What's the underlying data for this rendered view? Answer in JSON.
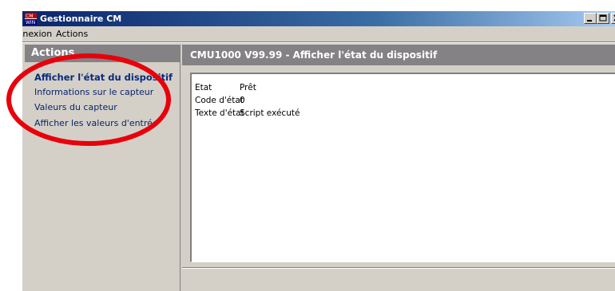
{
  "window": {
    "title": "Gestionnaire CM",
    "app_icon": "cm-app-icon",
    "caption_buttons": [
      "minimize-icon",
      "maximize-icon",
      "close-icon"
    ],
    "titlebar_color": "#0a246a"
  },
  "menu": {
    "items": [
      "Connexion",
      "Actions"
    ]
  },
  "sidebar": {
    "header": "Actions",
    "items": [
      {
        "label": "Afficher l'état du dispositif",
        "active": true
      },
      {
        "label": "Informations sur le capteur",
        "active": false
      },
      {
        "label": "Valeurs du capteur",
        "active": false
      },
      {
        "label": "Afficher les valeurs d'entrée",
        "active": false
      }
    ]
  },
  "main": {
    "header": "CMU1000 V99.99 - Afficher l'état du dispositif",
    "fields": [
      {
        "key": "Etat",
        "value": "Prêt"
      },
      {
        "key": "Code d'état",
        "value": "0"
      },
      {
        "key": "Texte d'état",
        "value": "Script exécuté"
      }
    ]
  },
  "annotation": {
    "shape": "ellipse",
    "color": "#e8000b"
  }
}
